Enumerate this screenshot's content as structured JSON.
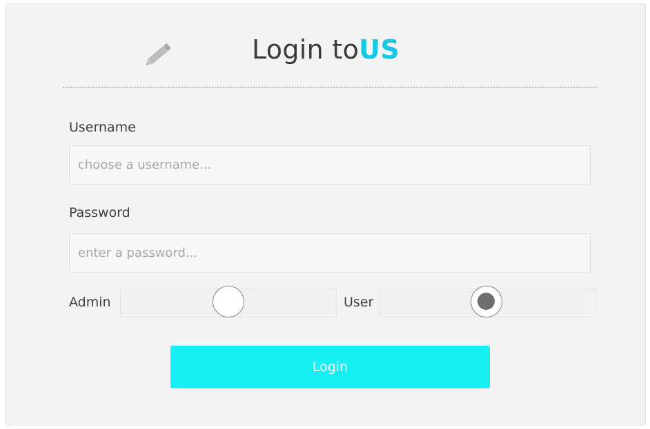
{
  "header": {
    "title_prefix": "Login to",
    "title_accent": "US",
    "icon": "pencil-icon"
  },
  "form": {
    "username_label": "Username",
    "username_placeholder": "choose a username...",
    "username_value": "",
    "password_label": "Password",
    "password_placeholder": "enter a password...",
    "password_value": "",
    "role_options": [
      {
        "label": "Admin",
        "selected": false
      },
      {
        "label": "User",
        "selected": true
      }
    ],
    "submit_label": "Login"
  },
  "colors": {
    "accent": "#18c6e8",
    "button": "#16f0f4",
    "card_background": "#f3f3f3"
  }
}
